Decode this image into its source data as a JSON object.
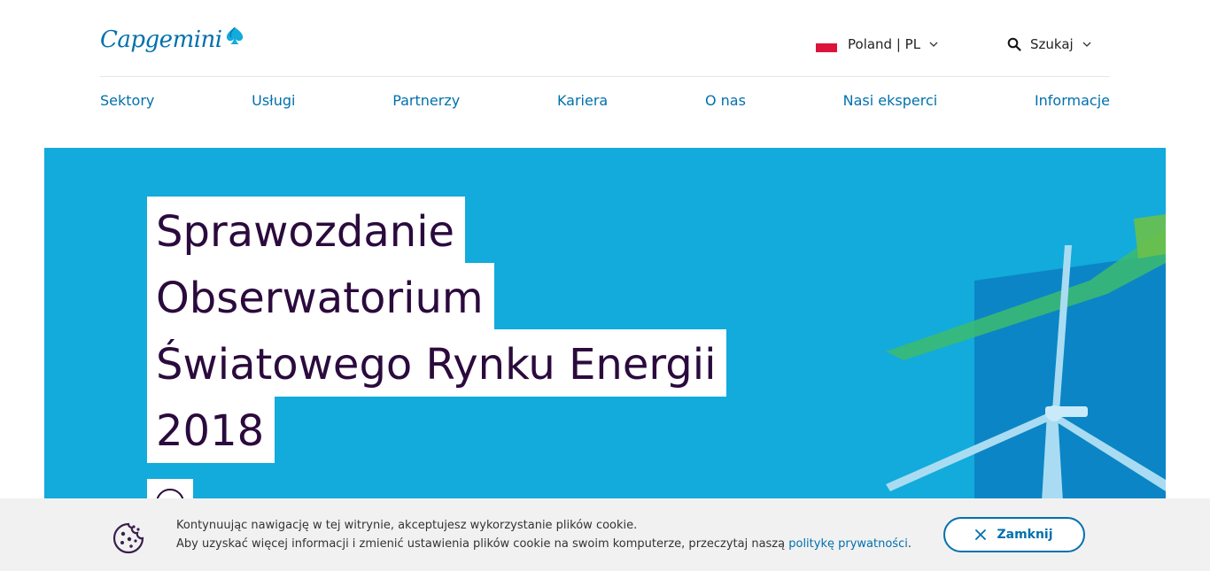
{
  "header": {
    "logo_text": "Capgemini",
    "country_label": "Poland | PL",
    "search_label": "Szukaj"
  },
  "nav": {
    "items": [
      "Sektory",
      "Usługi",
      "Partnerzy",
      "Kariera",
      "O nas",
      "Nasi eksperci",
      "Informacje"
    ]
  },
  "hero": {
    "title_lines": [
      "Sprawozdanie",
      "Obserwatorium",
      "Światowego Rynku Energii",
      "2018"
    ]
  },
  "cookie": {
    "line1": "Kontynuując nawigację w tej witrynie, akceptujesz wykorzystanie plików cookie.",
    "line2_prefix": "Aby uzyskać więcej informacji i zmienić ustawienia plików cookie na swoim komputerze, przeczytaj naszą ",
    "policy_link": "politykę prywatności",
    "line2_suffix": ".",
    "close_label": "Zamknij"
  },
  "colors": {
    "brand_blue": "#0070ad",
    "hero_bg": "#12abdb",
    "title_text": "#2b0a3d",
    "cookie_bg": "#f1f1f1"
  },
  "icons": {
    "logo": "spade-logo-icon",
    "country": "flag-poland-icon",
    "search": "search-icon",
    "close": "close-icon",
    "cookie": "cookie-icon"
  }
}
